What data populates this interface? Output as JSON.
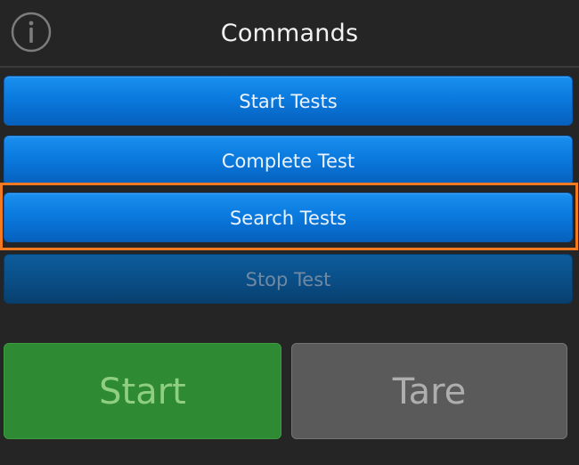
{
  "header": {
    "title": "Commands",
    "info_icon": "info-circle-icon"
  },
  "commands": [
    {
      "label": "Start Tests",
      "enabled": true
    },
    {
      "label": "Complete Test",
      "enabled": true
    },
    {
      "label": "Search Tests",
      "enabled": true,
      "highlighted": true
    },
    {
      "label": "Stop Test",
      "enabled": false
    }
  ],
  "actions": {
    "start_label": "Start",
    "tare_label": "Tare"
  },
  "colors": {
    "background": "#252525",
    "command_blue": "#0a79dd",
    "highlight_outline": "#f37a21",
    "start_green": "#2e8b33",
    "tare_gray": "#5a5a5a"
  }
}
